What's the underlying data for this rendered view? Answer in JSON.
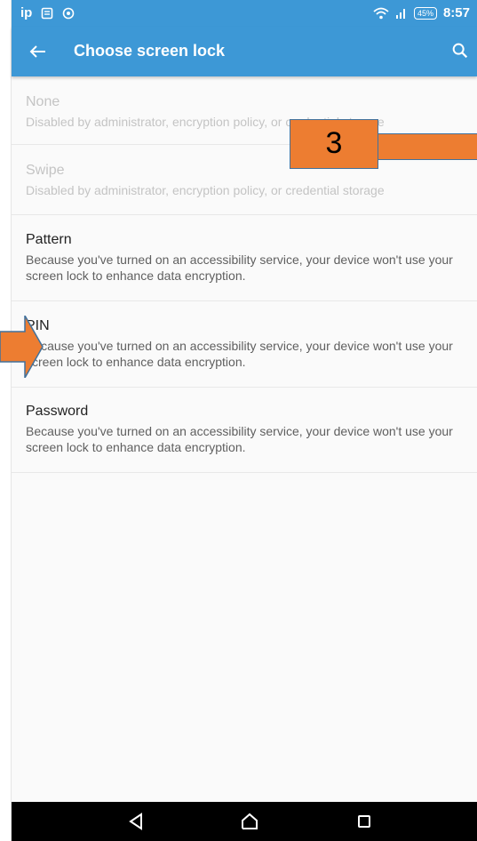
{
  "status_bar": {
    "left_text": "ip",
    "battery": "45%",
    "time": "8:57"
  },
  "app_bar": {
    "title": "Choose screen lock"
  },
  "options": [
    {
      "title": "None",
      "summary": "Disabled by administrator, encryption policy, or credential storage",
      "enabled": false
    },
    {
      "title": "Swipe",
      "summary": "Disabled by administrator, encryption policy, or credential storage",
      "enabled": false
    },
    {
      "title": "Pattern",
      "summary": "Because you've turned on an accessibility service, your device won't use your screen lock to enhance data encryption.",
      "enabled": true
    },
    {
      "title": "PIN",
      "summary": "Because you've turned on an accessibility service, your device won't use your screen lock to enhance data encryption.",
      "enabled": true
    },
    {
      "title": "Password",
      "summary": "Because you've turned on an accessibility service, your device won't use your screen lock to enhance data encryption.",
      "enabled": true
    }
  ],
  "overlay": {
    "callout_number": "3",
    "callout_color": "#ed7d31",
    "callout_border_color": "#41719c"
  },
  "colors": {
    "app_bar": "#3d98d6",
    "nav_bar": "#000000"
  },
  "icons": {
    "back": "arrow-left-icon",
    "search": "search-icon",
    "nav_back": "triangle-back-icon",
    "nav_home": "home-icon",
    "nav_recents": "square-recents-icon"
  }
}
